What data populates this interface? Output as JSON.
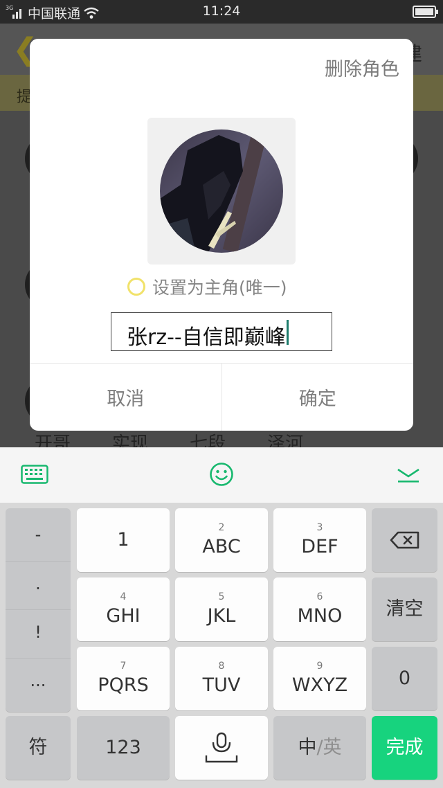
{
  "status_bar": {
    "network_tag": "3G",
    "carrier": "中国联通",
    "time": "11:24"
  },
  "background_page": {
    "header_right": "建",
    "tip": "提",
    "names": [
      "开哥",
      "实现",
      "七段",
      "泽河"
    ]
  },
  "dialog": {
    "delete_label": "删除角色",
    "radio_label": "设置为主角(唯一)",
    "name_value": "张rz--自信即巅峰",
    "cancel_label": "取消",
    "confirm_label": "确定"
  },
  "keyboard": {
    "symbols": [
      "-",
      ".",
      "!",
      "..."
    ],
    "keys": [
      {
        "num": "",
        "label": "1"
      },
      {
        "num": "2",
        "label": "ABC"
      },
      {
        "num": "3",
        "label": "DEF"
      },
      {
        "num": "4",
        "label": "GHI"
      },
      {
        "num": "5",
        "label": "JKL"
      },
      {
        "num": "6",
        "label": "MNO"
      },
      {
        "num": "7",
        "label": "PQRS"
      },
      {
        "num": "8",
        "label": "TUV"
      },
      {
        "num": "9",
        "label": "WXYZ"
      }
    ],
    "clear_label": "清空",
    "zero_label": "0",
    "symbol_label": "符",
    "num_label": "123",
    "ime_cn": "中",
    "ime_slash": "/",
    "ime_en": "英",
    "done_label": "完成"
  },
  "colors": {
    "accent_green": "#17d37e",
    "radio_yellow": "#f1e26a",
    "caret": "#1e7c6c"
  },
  "icons": {
    "toolbar": [
      "keyboard-icon",
      "emoji-icon",
      "collapse-keyboard-icon"
    ],
    "keys": [
      "backspace-icon",
      "microphone-icon"
    ]
  }
}
